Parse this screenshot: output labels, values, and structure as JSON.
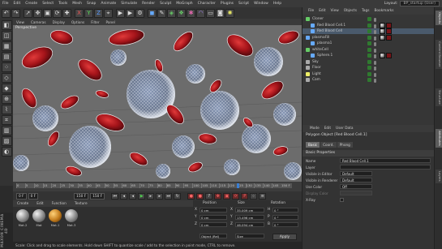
{
  "menubar": {
    "items": [
      "File",
      "Edit",
      "Create",
      "Select",
      "Tools",
      "Mesh",
      "Snap",
      "Animate",
      "Simulate",
      "Render",
      "Sculpt",
      "MoGraph",
      "Character",
      "Plugins",
      "Script",
      "Window",
      "Help"
    ],
    "layout_label": "Layout:",
    "layout_value": "BP_startup (User)"
  },
  "viewport": {
    "menu": [
      "View",
      "Cameras",
      "Display",
      "Options",
      "Filter",
      "Panel"
    ],
    "label": "Perspective"
  },
  "timeline": {
    "ticks": [
      "0",
      "5",
      "10",
      "15",
      "20",
      "25",
      "30",
      "35",
      "40",
      "45",
      "50",
      "55",
      "60",
      "65",
      "70",
      "75",
      "80",
      "85",
      "90",
      "95",
      "100",
      "105",
      "110",
      "115",
      "120",
      "125",
      "130",
      "135",
      "140",
      "145"
    ],
    "end_label": "150 F",
    "current_frame": 125
  },
  "transport": {
    "start": "0 F",
    "current": "0 F",
    "end": "150 F",
    "end2": "150 F"
  },
  "materials": {
    "menu": [
      "Create",
      "Edit",
      "Function",
      "Texture"
    ],
    "items": [
      {
        "name": "Mat.2"
      },
      {
        "name": "Mat"
      },
      {
        "name": "Mat.1"
      },
      {
        "name": "Mat.3"
      }
    ]
  },
  "coordinates": {
    "headers": [
      "Position",
      "Size",
      "Rotation"
    ],
    "rows": [
      {
        "axis": "X",
        "pos": "0 cm",
        "size_axis": "X",
        "size": "35.009 cm",
        "rot_axis": "H",
        "rot": "0 °"
      },
      {
        "axis": "Y",
        "pos": "0 cm",
        "size_axis": "Y",
        "size": "13.496 cm",
        "rot_axis": "P",
        "rot": "0 °"
      },
      {
        "axis": "Z",
        "pos": "0 cm",
        "size_axis": "Z",
        "size": "46.094 cm",
        "rot_axis": "B",
        "rot": "0 °"
      }
    ],
    "mode1": "Object (Rel)",
    "mode2": "Size",
    "apply_label": "Apply"
  },
  "status": {
    "text": "Scale: Click and drag to scale elements. Hold down SHIFT to quantize scale / add to the selection in point mode, CTRL to remove."
  },
  "logo": {
    "text": "MAXON CINEMA 4D"
  },
  "objects": {
    "menu": [
      "File",
      "Edit",
      "View",
      "Objects",
      "Tags",
      "Bookmarks"
    ],
    "rows": [
      {
        "name": "Cloner",
        "indent": 0
      },
      {
        "name": "Red Blood Cell.1",
        "indent": 1
      },
      {
        "name": "Red Blood Cell",
        "indent": 1,
        "selected": true
      },
      {
        "name": "plasmaFill",
        "indent": 0
      },
      {
        "name": "plasma1",
        "indent": 1
      },
      {
        "name": "whiteCell",
        "indent": 0
      },
      {
        "name": "Sphere.1",
        "indent": 1
      },
      {
        "name": "Sky",
        "indent": 0
      },
      {
        "name": "Floor",
        "indent": 0
      },
      {
        "name": "Light",
        "indent": 0
      },
      {
        "name": "Cam",
        "indent": 0
      }
    ]
  },
  "attributes": {
    "menu": [
      "Mode",
      "Edit",
      "User Data"
    ],
    "title": "Polygon Object [Red Blood Cell.1]",
    "tabs": [
      "Basic",
      "Coord.",
      "Phong"
    ],
    "active_tab": "Basic",
    "section": "Basic Properties",
    "rows": [
      {
        "label": "Name",
        "value": "Red Blood Cell.1"
      },
      {
        "label": "Layer",
        "value": ""
      },
      {
        "label": "Visible in Editor",
        "value": "Default"
      },
      {
        "label": "Visible in Renderer",
        "value": "Default"
      },
      {
        "label": "Use Color",
        "value": "Off"
      },
      {
        "label": "Display Color",
        "value": ""
      },
      {
        "label": "X-Ray",
        "value": ""
      }
    ]
  },
  "right_tabs": [
    "Objects",
    "Content Browser",
    "Structure",
    "Attributes",
    "Layers"
  ],
  "colors": {
    "selection": "#4a5a6c",
    "play_green": "#4fd04f",
    "record_red": "#e04040",
    "blood_red": "#b0181c"
  }
}
